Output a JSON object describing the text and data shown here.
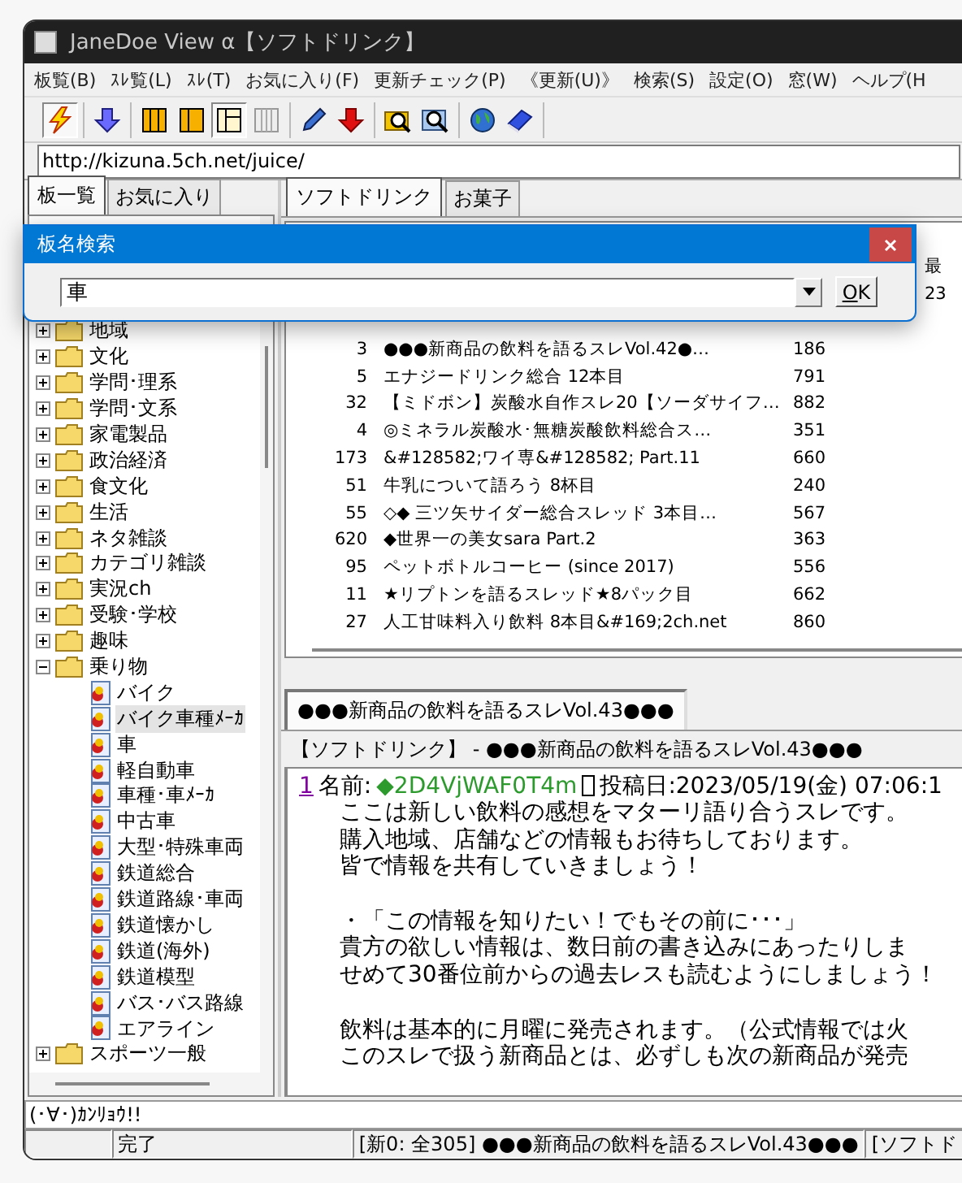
{
  "window": {
    "title": "JaneDoe View α【ソフトドリンク】"
  },
  "menu": [
    "板覧(B)",
    "ｽﾚ覧(L)",
    "ｽﾚ(T)",
    "お気に入り(F)",
    "更新チェック(P)",
    "《更新(U)》",
    "検索(S)",
    "設定(O)",
    "窓(W)",
    "ヘルプ(H"
  ],
  "toolbar": [
    [
      {
        "kind": "lightning",
        "pressed": true
      }
    ],
    [
      {
        "kind": "blue_down",
        "pressed": false
      }
    ],
    [
      {
        "kind": "three_columns",
        "pressed": false
      },
      {
        "kind": "two_columns",
        "pressed": false
      },
      {
        "kind": "pane_layout",
        "pressed": true
      },
      {
        "kind": "grid",
        "pressed": false
      }
    ],
    [
      {
        "kind": "pencil",
        "pressed": false
      },
      {
        "kind": "red_down",
        "pressed": false
      }
    ],
    [
      {
        "kind": "folder_search",
        "pressed": false
      },
      {
        "kind": "search",
        "pressed": false
      }
    ],
    [
      {
        "kind": "globe",
        "pressed": false
      },
      {
        "kind": "book",
        "pressed": false
      }
    ]
  ],
  "address": {
    "value": "http://kizuna.5ch.net/juice/"
  },
  "board_tabs": [
    {
      "label": "板一覧",
      "selected": true
    },
    {
      "label": "お気に入り",
      "selected": false
    }
  ],
  "board_tree": [
    {
      "label": "地域",
      "expanded": false
    },
    {
      "label": "文化",
      "expanded": false
    },
    {
      "label": "学問･理系",
      "expanded": false
    },
    {
      "label": "学問･文系",
      "expanded": false
    },
    {
      "label": "家電製品",
      "expanded": false
    },
    {
      "label": "政治経済",
      "expanded": false
    },
    {
      "label": "食文化",
      "expanded": false
    },
    {
      "label": "生活",
      "expanded": false
    },
    {
      "label": "ネタ雑談",
      "expanded": false
    },
    {
      "label": "カテゴリ雑談",
      "expanded": false
    },
    {
      "label": "実況ch",
      "expanded": false
    },
    {
      "label": "受験･学校",
      "expanded": false
    },
    {
      "label": "趣味",
      "expanded": false
    },
    {
      "label": "乗り物",
      "expanded": true,
      "children": [
        {
          "label": "バイク",
          "selected": false
        },
        {
          "label": "バイク車種ﾒｰｶ",
          "selected": true
        },
        {
          "label": "車",
          "selected": false
        },
        {
          "label": "軽自動車",
          "selected": false
        },
        {
          "label": "車種･車ﾒｰｶ",
          "selected": false
        },
        {
          "label": "中古車",
          "selected": false
        },
        {
          "label": "大型･特殊車両",
          "selected": false
        },
        {
          "label": "鉄道総合",
          "selected": false
        },
        {
          "label": "鉄道路線･車両",
          "selected": false
        },
        {
          "label": "鉄道懐かし",
          "selected": false
        },
        {
          "label": "鉄道(海外)",
          "selected": false
        },
        {
          "label": "鉄道模型",
          "selected": false
        },
        {
          "label": "バス･バス路線",
          "selected": false
        },
        {
          "label": "エアライン",
          "selected": false
        }
      ]
    },
    {
      "label": "スポーツ一般",
      "expanded": false
    }
  ],
  "list_tabs": [
    {
      "label": "ソフトドリンク",
      "selected": true
    },
    {
      "label": "お菓子",
      "selected": false
    }
  ],
  "thread_list": {
    "column_4_header": "最",
    "first_row_column_4": "23",
    "rows": [
      {
        "number": "3",
        "title": "●●●新商品の飲料を語るスレVol.42●…",
        "count": "186"
      },
      {
        "number": "5",
        "title": "エナジードリンク総合 12本目",
        "count": "791"
      },
      {
        "number": "32",
        "title": "【ミドボン】炭酸水自作スレ20【ソーダサイフ…",
        "count": "882"
      },
      {
        "number": "4",
        "title": "◎ミネラル炭酸水･無糖炭酸飲料総合ス…",
        "count": "351"
      },
      {
        "number": "173",
        "title": "&#128582;ワイ専&#128582;  Part.11",
        "count": "660"
      },
      {
        "number": "51",
        "title": "牛乳について語ろう 8杯目",
        "count": "240"
      },
      {
        "number": "55",
        "title": "◇◆  三ツ矢サイダー総合スレッド  3本目…",
        "count": "567"
      },
      {
        "number": "620",
        "title": "◆世界一の美女sara  Part.2",
        "count": "363"
      },
      {
        "number": "95",
        "title": "ペットボトルコーヒー (since 2017)",
        "count": "556"
      },
      {
        "number": "11",
        "title": "★リプトンを語るスレッド★8パック目",
        "count": "662"
      },
      {
        "number": "27",
        "title": "人工甘味料入り飲料 8本目&#169;2ch.net",
        "count": "860"
      }
    ]
  },
  "thread_tabs": [
    {
      "label": "●●●新商品の飲料を語るスレVol.43●●●",
      "selected": true
    }
  ],
  "thread_title": "【ソフトドリンク】 - ●●●新商品の飲料を語るスレVol.43●●●",
  "post": {
    "number": "1",
    "name_label": "名前:",
    "trip": "◆2D4VjWAF0T4m",
    "date": "投稿日:2023/05/19(金) 07:06:1",
    "paragraphs": [
      [
        "ここは新しい飲料の感想をマターリ語り合うスレです。",
        "購入地域、店舗などの情報もお待ちしております。",
        "皆で情報を共有していきましょう！"
      ],
      [
        "・「この情報を知りたい！でもその前に･･･」",
        "貴方の欲しい情報は、数日前の書き込みにあったりしま",
        "せめて30番位前からの過去レスも読むようにしましょう！"
      ],
      [
        "飲料は基本的に月曜に発売されます。（公式情報では火",
        "このスレで扱う新商品とは、必ずしも次の新商品が発売"
      ]
    ]
  },
  "status_line": "(･∀･)ｶﾝﾘｮｳ!!",
  "status_bar": [
    "完了",
    "[新0: 全305] ●●●新商品の飲料を語るスレVol.43●●●",
    "[ソフトド"
  ],
  "dialog": {
    "title": "板名検索",
    "value": "車",
    "button": "OK"
  }
}
